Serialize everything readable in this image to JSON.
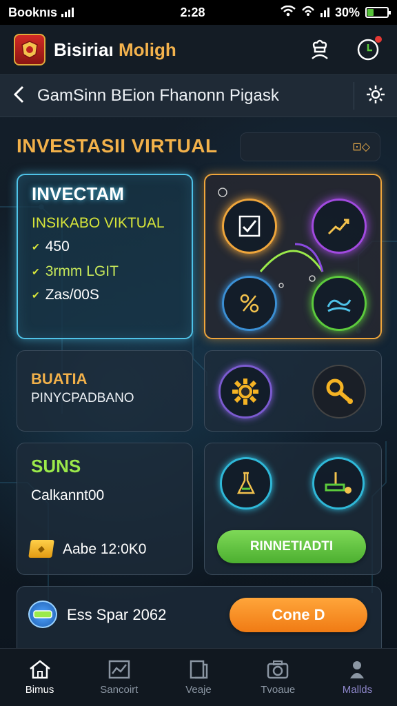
{
  "status_bar": {
    "carrier": "Booknıs",
    "time": "2:28",
    "battery_text": "30%",
    "battery_level": 0.3
  },
  "app_header": {
    "title_part1": "Bisiriaı",
    "title_part2": "Moligh",
    "icons": [
      "app-logo",
      "chef-profile-icon",
      "clock-notification-icon"
    ]
  },
  "nav_bar": {
    "title": "GamSinn BEion Fhanonn Pigask",
    "back_icon": "chevron-left-icon",
    "settings_icon": "gear-icon"
  },
  "section": {
    "title": "INVESTASII VIRTUAL",
    "search_icons": "⊡◇"
  },
  "card_invest": {
    "title": "INVECTAM",
    "subtitle": "INSIKABO VIKTUAL",
    "items": [
      "450",
      "3rmm LGIT",
      "Zas/00S"
    ]
  },
  "card_icons_top": {
    "icons": [
      "checklist-icon",
      "chart-hand-icon",
      "percent-icon",
      "handshake-icon"
    ]
  },
  "card_status": {
    "title": "BUATIA",
    "subtitle": "PINYCPADBANO"
  },
  "card_tools": {
    "icons": [
      "gear-icon",
      "key-search-icon"
    ]
  },
  "card_suns": {
    "title": "SUNS",
    "value": "Calkannt00",
    "coin_text": "Aabe 12:0K0"
  },
  "card_actions": {
    "icons": [
      "flask-icon",
      "joystick-icon"
    ],
    "button_label": "RINNETIADTI"
  },
  "card_bottom": {
    "label": "Ess Spar 2062",
    "button_label": "Cone D"
  },
  "bottom_nav": {
    "items": [
      {
        "label": "Bimus",
        "icon": "home-icon"
      },
      {
        "label": "Sancoirt",
        "icon": "chart-icon"
      },
      {
        "label": "Veaje",
        "icon": "document-icon"
      },
      {
        "label": "Tvoaue",
        "icon": "camera-icon"
      },
      {
        "label": "Mallds",
        "icon": "person-icon"
      }
    ]
  },
  "colors": {
    "accent_orange": "#f2b14a",
    "accent_cyan": "#4fc3e8",
    "accent_green": "#7ed957",
    "button_orange": "#f58a1f"
  }
}
